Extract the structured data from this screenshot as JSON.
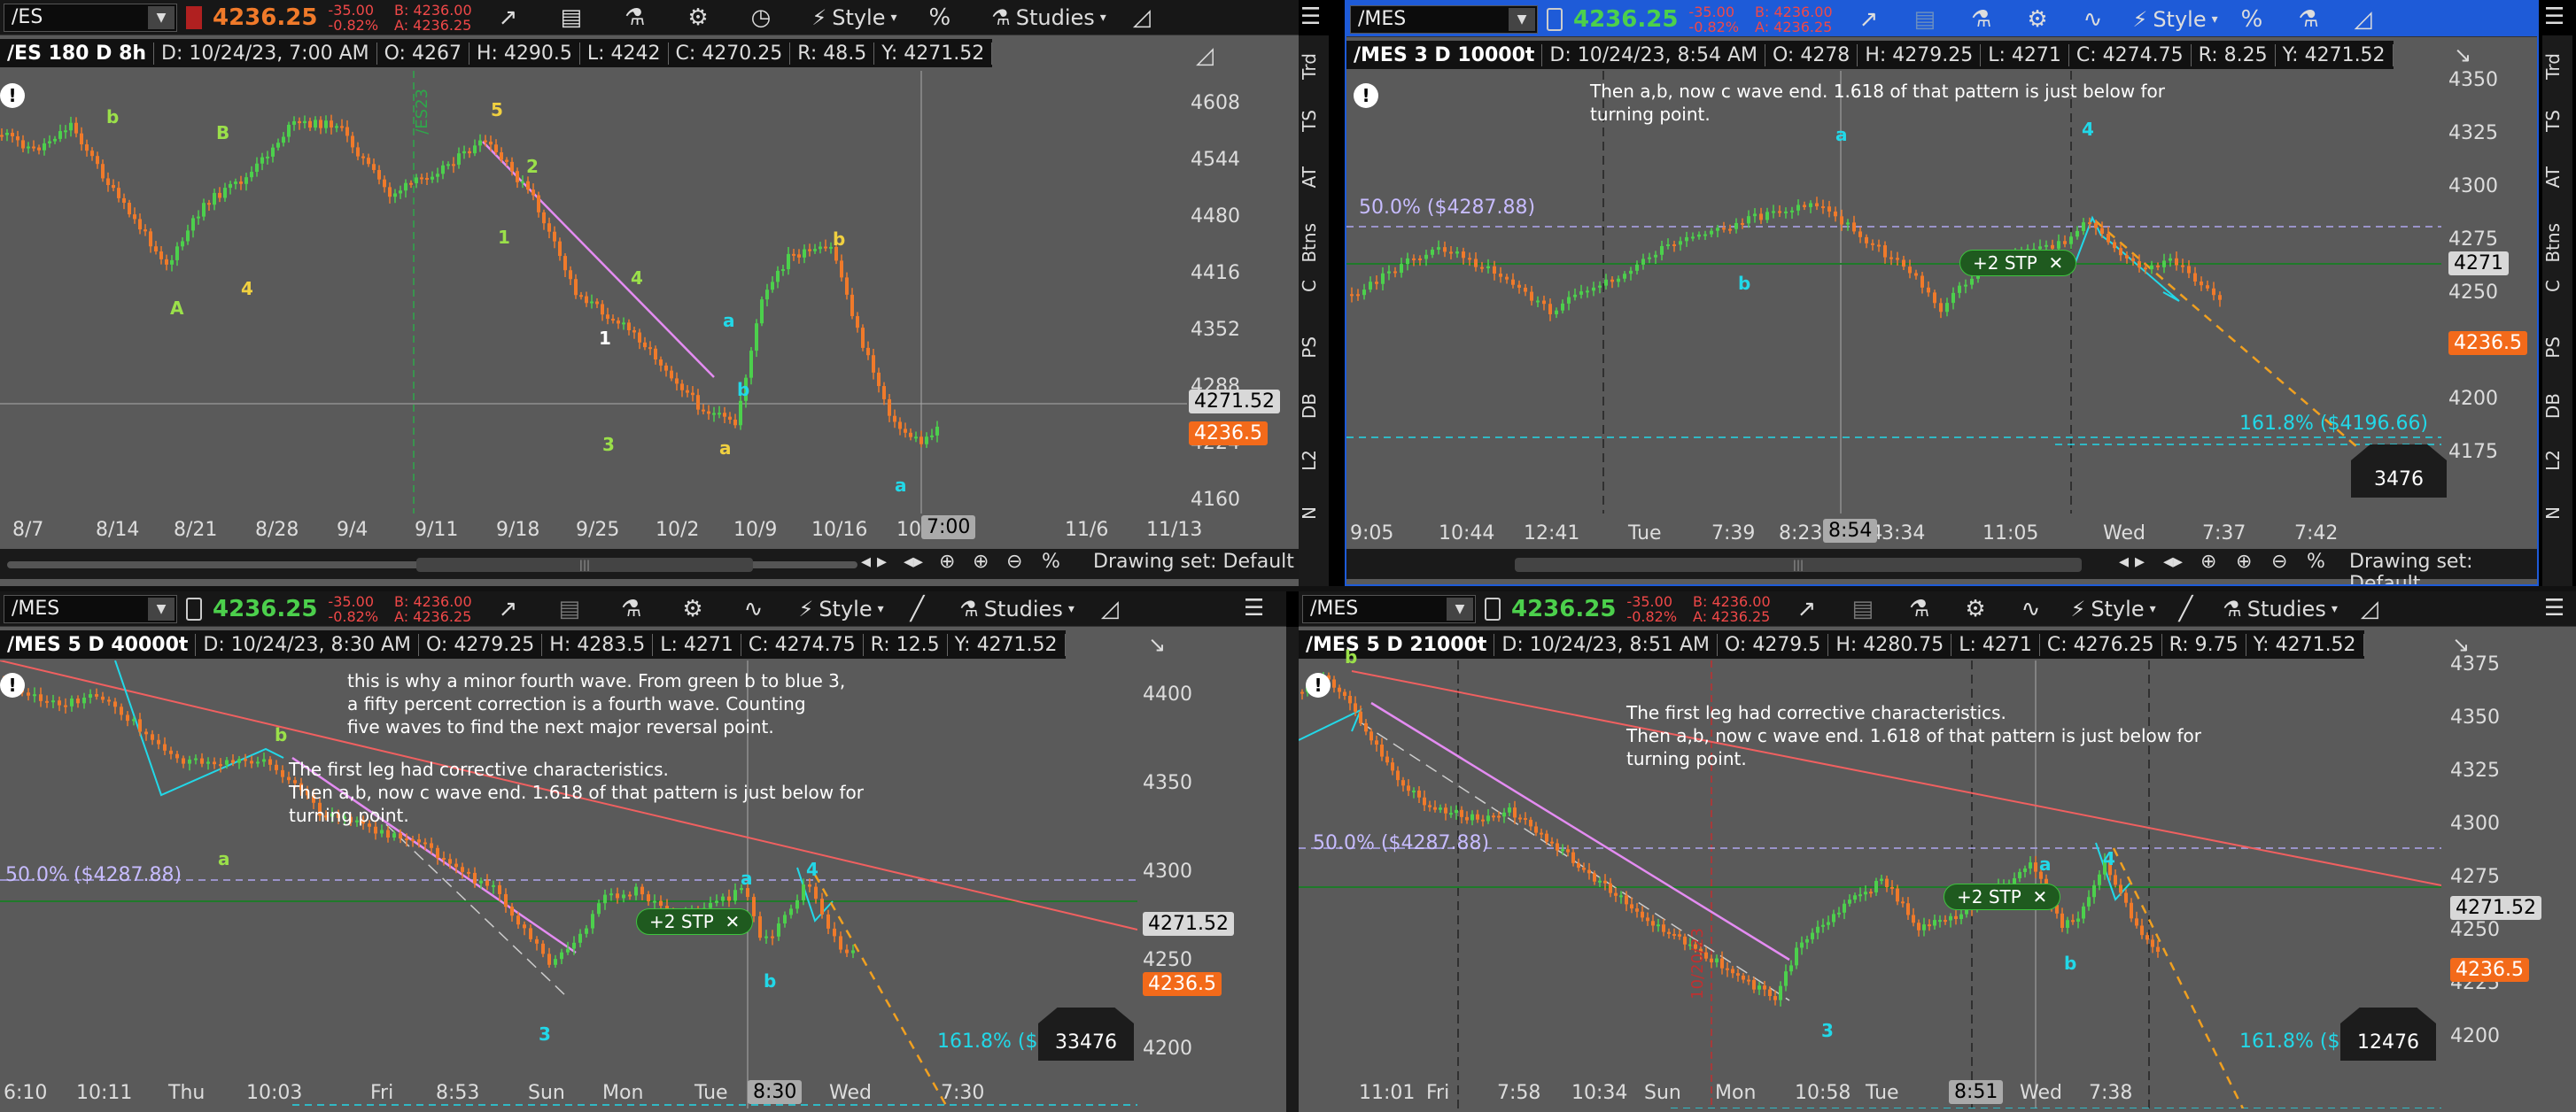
{
  "panels": [
    {
      "id": "tl",
      "symbol": "/ES",
      "last": "4236.25",
      "change": "-35.00",
      "change_pct": "-0.82%",
      "bid": "B: 4236.00",
      "ask": "A: 4236.25",
      "style_label": "Style",
      "studies_label": "Studies",
      "info": {
        "title": "/ES 180 D 8h",
        "date": "D: 10/24/23, 7:00 AM",
        "open": "O: 4267",
        "high": "H: 4290.5",
        "low": "L: 4242",
        "close": "C: 4270.25",
        "range": "R: 48.5",
        "y": "Y: 4271.52"
      },
      "y_ticks": [
        "4608",
        "4544",
        "4480",
        "4416",
        "4352",
        "4288",
        "4224",
        "4160"
      ],
      "price_tag_gray": "4271.52",
      "price_tag_orange": "4236.5",
      "x_ticks": [
        "8/7",
        "8/14",
        "8/21",
        "8/28",
        "9/4",
        "9/11",
        "9/18",
        "9/25",
        "10/2",
        "10/9",
        "10/16",
        "10",
        "11/6",
        "11/13"
      ],
      "time_tag": "7:00",
      "drawing_set": "Drawing set: Default",
      "vline_label": "/ES23",
      "wave_labels": [
        {
          "t": "b",
          "c": "#9be04a"
        },
        {
          "t": "B",
          "c": "#9be04a"
        },
        {
          "t": "A",
          "c": "#9be04a"
        },
        {
          "t": "4",
          "c": "#f0d040"
        },
        {
          "t": "5",
          "c": "#f0d040"
        },
        {
          "t": "2",
          "c": "#9be04a"
        },
        {
          "t": "1",
          "c": "#9be04a"
        },
        {
          "t": "4",
          "c": "#9be04a"
        },
        {
          "t": "1",
          "c": "#ffffff"
        },
        {
          "t": "3",
          "c": "#9be04a"
        },
        {
          "t": "a",
          "c": "#22d8e8"
        },
        {
          "t": "b",
          "c": "#22d8e8"
        },
        {
          "t": "a",
          "c": "#f0d040"
        },
        {
          "t": "b",
          "c": "#f0d040"
        },
        {
          "t": "a",
          "c": "#22d8e8"
        }
      ]
    },
    {
      "id": "tr",
      "symbol": "/MES",
      "last": "4236.25",
      "change": "-35.00",
      "change_pct": "-0.82%",
      "bid": "B: 4236.00",
      "ask": "A: 4236.25",
      "style_label": "Style",
      "info": {
        "title": "/MES 3 D 10000t",
        "date": "D: 10/24/23, 8:54 AM",
        "open": "O: 4278",
        "high": "H: 4279.25",
        "low": "L: 4271",
        "close": "C: 4274.75",
        "range": "R: 8.25",
        "y": "Y: 4271.52"
      },
      "annotation": [
        "Then a,b, now c wave end. 1.618 of that pattern is just below for",
        "turning point."
      ],
      "fifty_pct": "50.0%  ($4287.88)",
      "fib_label": "161.8%  ($4196.66)",
      "stp_label": "+2 STP",
      "stp_close": "✕",
      "y_ticks": [
        "4350",
        "4325",
        "4300",
        "4275",
        "4250",
        "4225",
        "4200",
        "4175"
      ],
      "price_tag_gray": "4271",
      "price_tag_orange": "4236.5",
      "count": "3476",
      "x_ticks": [
        "9:05",
        "10:44",
        "12:41",
        "Tue",
        "7:39",
        "8:23",
        "8:54",
        "3:34",
        "11:05",
        "Wed",
        "7:37",
        "7:42"
      ],
      "time_tag": "8:54",
      "drawing_set": "Drawing set: Default",
      "wave_labels": [
        {
          "t": "a",
          "c": "#22d8e8"
        },
        {
          "t": "4",
          "c": "#22d8e8"
        },
        {
          "t": "b",
          "c": "#22d8e8"
        }
      ]
    },
    {
      "id": "bl",
      "symbol": "/MES",
      "last": "4236.25",
      "change": "-35.00",
      "change_pct": "-0.82%",
      "bid": "B: 4236.00",
      "ask": "A: 4236.25",
      "style_label": "Style",
      "studies_label": "Studies",
      "info": {
        "title": "/MES 5 D 40000t",
        "date": "D: 10/24/23, 8:30 AM",
        "open": "O: 4279.25",
        "high": "H: 4283.5",
        "low": "L: 4271",
        "close": "C: 4274.75",
        "range": "R: 12.5",
        "y": "Y: 4271.52"
      },
      "annotation_top": [
        "this is why a minor fourth wave. From green b to blue 3,",
        "a fifty percent correction is a fourth wave. Counting",
        "five waves to find the next major reversal point."
      ],
      "annotation": [
        "The first leg had corrective characteristics.",
        "Then a,b, now c wave end. 1.618 of that pattern is just below for",
        "turning point."
      ],
      "fifty_pct": "50.0%  ($4287.88)",
      "fib_label": "161.8%  ($4",
      "stp_label": "+2 STP",
      "stp_close": "✕",
      "y_ticks": [
        "4400",
        "4350",
        "4300",
        "4250",
        "4200"
      ],
      "price_tag_gray": "4271.52",
      "price_tag_orange": "4236.5",
      "count": "33476",
      "x_ticks": [
        "6:10",
        "10:11",
        "Thu",
        "10:03",
        "Fri",
        "8:53",
        "Sun",
        "Mon",
        "Tue",
        "8:30",
        "Wed",
        "7:30"
      ],
      "time_tag": "8:30",
      "wave_labels": [
        {
          "t": "b",
          "c": "#9be04a"
        },
        {
          "t": "a",
          "c": "#9be04a"
        },
        {
          "t": "3",
          "c": "#22d8e8"
        },
        {
          "t": "a",
          "c": "#22d8e8"
        },
        {
          "t": "4",
          "c": "#22d8e8"
        },
        {
          "t": "b",
          "c": "#22d8e8"
        }
      ]
    },
    {
      "id": "br",
      "symbol": "/MES",
      "last": "4236.25",
      "change": "-35.00",
      "change_pct": "-0.82%",
      "bid": "B: 4236.00",
      "ask": "A: 4236.25",
      "style_label": "Style",
      "studies_label": "Studies",
      "info": {
        "title": "/MES 5 D 21000t",
        "date": "D: 10/24/23, 8:51 AM",
        "open": "O: 4279.5",
        "high": "H: 4280.75",
        "low": "L: 4271",
        "close": "C: 4276.25",
        "range": "R: 9.75",
        "y": "Y: 4271.52"
      },
      "annotation": [
        "The first leg had corrective characteristics.",
        "Then a,b, now c wave end. 1.618 of that pattern is just below for",
        "turning point."
      ],
      "fifty_pct": "50.0%  ($4287.88)",
      "fib_label": "161.8%  ($4",
      "stp_label": "+2 STP",
      "stp_close": "✕",
      "y_ticks": [
        "4375",
        "4350",
        "4325",
        "4300",
        "4275",
        "4250",
        "4225",
        "4200"
      ],
      "price_tag_gray": "4271.52",
      "price_tag_orange": "4236.5",
      "count": "12476",
      "vline_label": "10/20/23",
      "x_ticks": [
        "11:01",
        "Fri",
        "7:58",
        "10:34",
        "Sun",
        "Mon",
        "10:58",
        "Tue",
        "8",
        "Wed",
        "7:38"
      ],
      "time_tag": "8:51",
      "wave_labels": [
        {
          "t": "b",
          "c": "#9be04a"
        },
        {
          "t": "3",
          "c": "#22d8e8"
        },
        {
          "t": "a",
          "c": "#22d8e8"
        },
        {
          "t": "4",
          "c": "#22d8e8"
        },
        {
          "t": "b",
          "c": "#22d8e8"
        }
      ]
    }
  ],
  "side_tabs": [
    "Trd",
    "TS",
    "AT",
    "Btns",
    "C",
    "PS",
    "DB",
    "L2",
    "N"
  ],
  "colors": {
    "up": "#4cd04c",
    "down": "#f07a2a",
    "cyan": "#22d8e8",
    "magenta": "#e48cf2",
    "red_line": "#f06060",
    "fifty": "#b0a6f0",
    "bg": "#5a5a5a"
  },
  "icons": [
    "share-icon",
    "news-icon",
    "flask-icon",
    "gear-icon",
    "clock-icon",
    "style-icon",
    "percent-icon",
    "studies-icon",
    "drawing-icon",
    "menu-icon"
  ]
}
